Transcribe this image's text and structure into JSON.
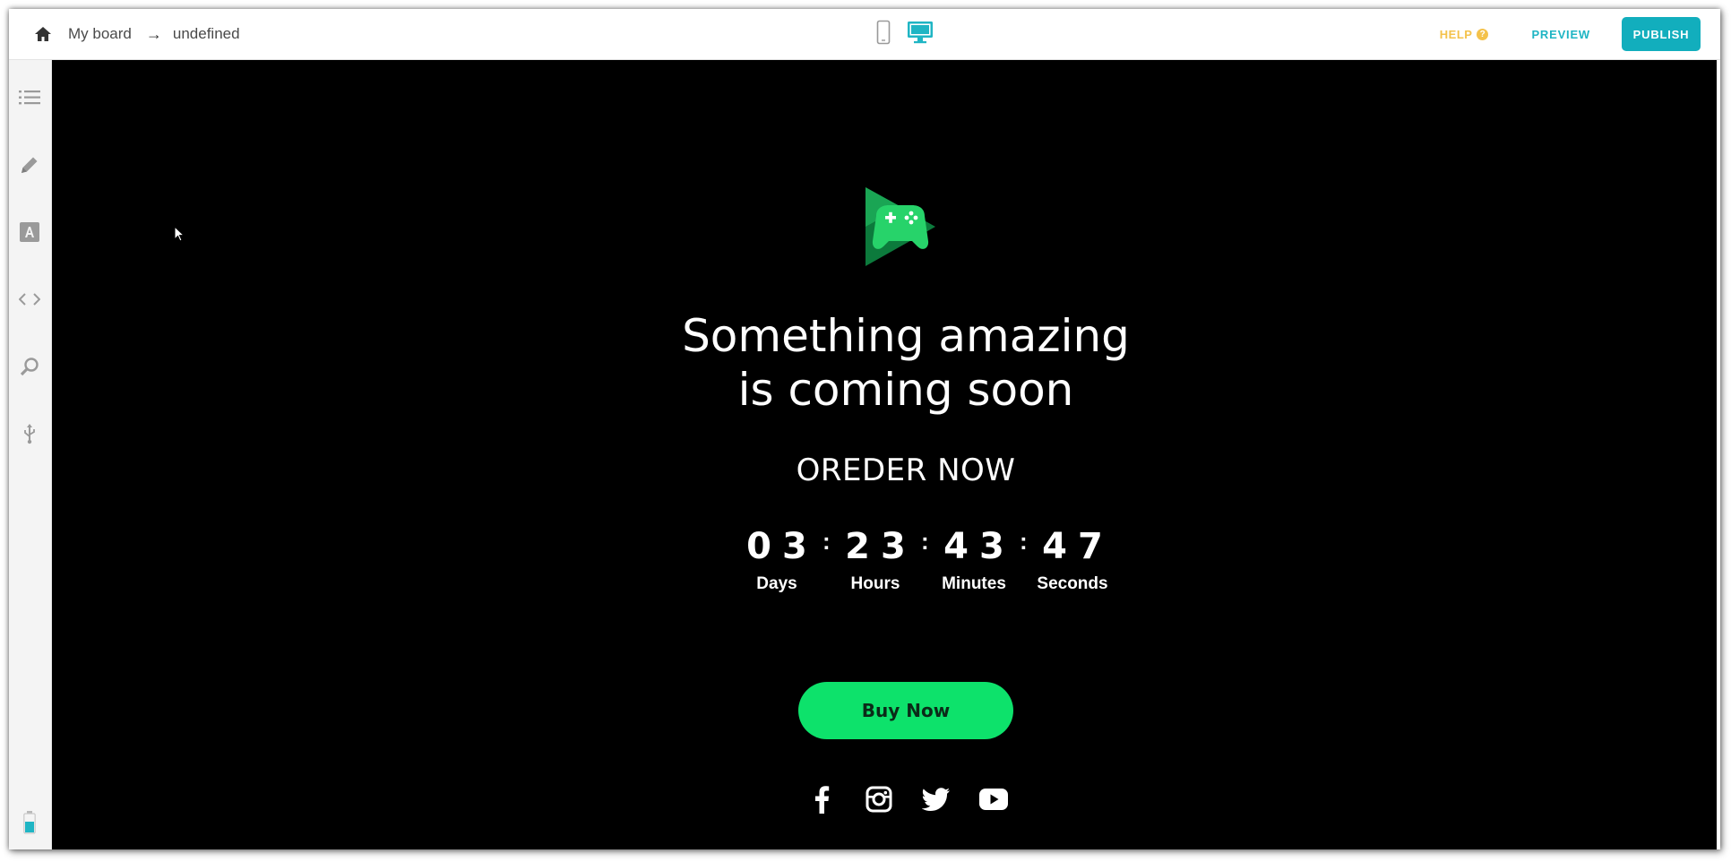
{
  "breadcrumb": {
    "home_icon": "home-icon",
    "board": "My board",
    "arrow": "→",
    "page": "undefined"
  },
  "device_toggle": {
    "mobile_icon": "mobile-phone-icon",
    "desktop_icon": "desktop-monitor-icon",
    "active": "desktop",
    "active_color": "#1fb5c4"
  },
  "actions": {
    "help": "HELP",
    "preview": "PREVIEW",
    "publish": "PUBLISH",
    "help_color": "#f4c24b",
    "publish_color": "#12aebd"
  },
  "sidebar": {
    "items": [
      {
        "icon": "list-icon"
      },
      {
        "icon": "pencil-icon"
      },
      {
        "icon": "font-icon"
      },
      {
        "icon": "code-icon"
      },
      {
        "icon": "seo-search-icon"
      },
      {
        "icon": "usb-integration-icon"
      }
    ],
    "footer_icon": "battery-icon"
  },
  "page": {
    "background": "#000000",
    "logo_icon": "game-controller-play-logo",
    "headline_line1": "Something amazing",
    "headline_line2": "is coming soon",
    "subheading": "OREDER NOW",
    "countdown": [
      {
        "value": "03",
        "label": "Days"
      },
      {
        "value": "23",
        "label": "Hours"
      },
      {
        "value": "43",
        "label": "Minutes"
      },
      {
        "value": "47",
        "label": "Seconds"
      }
    ],
    "separator": ":",
    "cta": "Buy Now",
    "cta_color": "#0de26b",
    "socials": [
      "facebook-icon",
      "instagram-icon",
      "twitter-icon",
      "youtube-icon"
    ]
  }
}
